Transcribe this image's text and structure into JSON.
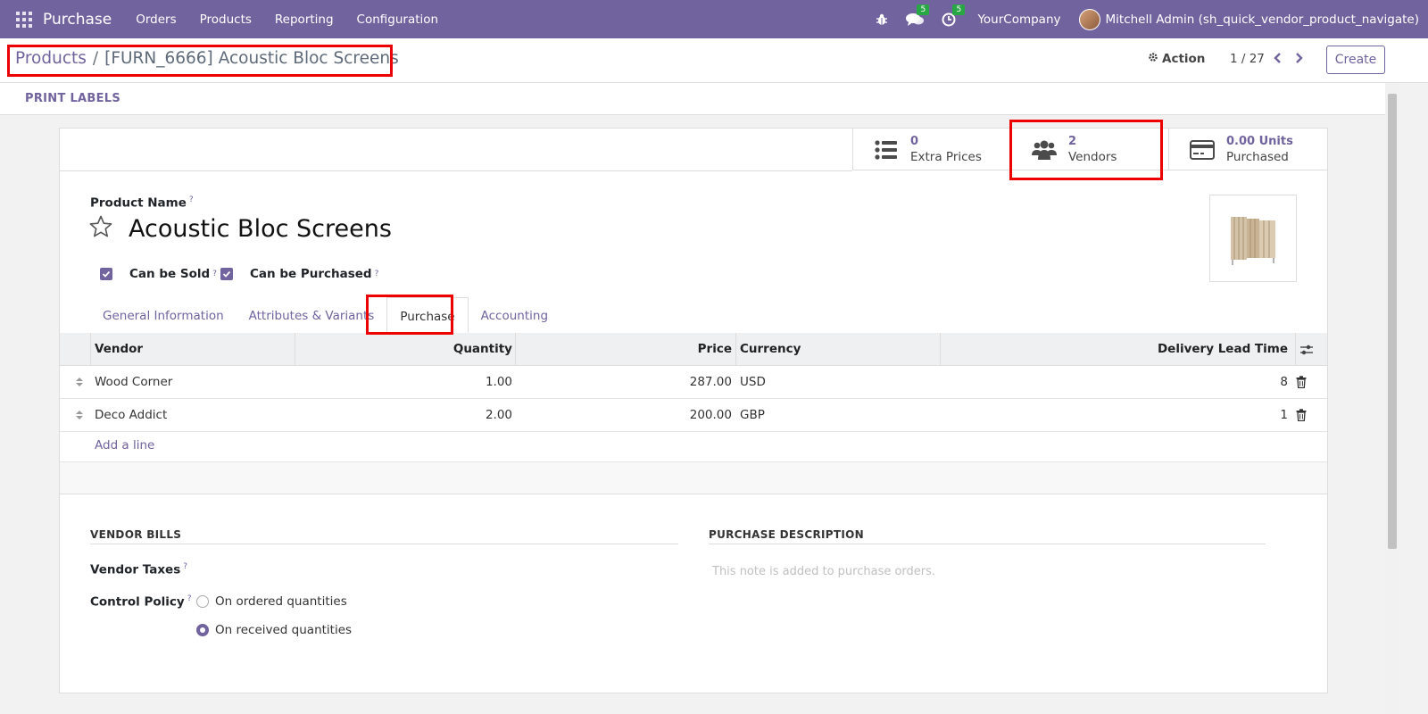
{
  "navbar": {
    "app_name": "Purchase",
    "menu": [
      "Orders",
      "Products",
      "Reporting",
      "Configuration"
    ],
    "messages_count": "5",
    "activities_count": "5",
    "company": "YourCompany",
    "user": "Mitchell Admin (sh_quick_vendor_product_navigate)"
  },
  "control": {
    "breadcrumb_parent": "Products",
    "breadcrumb_sep": "/",
    "breadcrumb_current": "[FURN_6666] Acoustic Bloc Screens",
    "action_label": "Action",
    "pager": "1 / 27",
    "create_label": "Create"
  },
  "statusbar": {
    "print_labels": "PRINT LABELS"
  },
  "smart_buttons": [
    {
      "value": "0",
      "label": "Extra Prices",
      "icon": "list-icon"
    },
    {
      "value": "2",
      "label": "Vendors",
      "icon": "users-icon"
    },
    {
      "value": "0.00 Units",
      "label": "Purchased",
      "icon": "credit-card-icon"
    }
  ],
  "product": {
    "name_label": "Product Name",
    "help_mark": "?",
    "name": "Acoustic Bloc Screens",
    "can_be_sold_label": "Can be Sold",
    "can_be_purchased_label": "Can be Purchased",
    "can_be_sold": true,
    "can_be_purchased": true
  },
  "tabs": [
    "General Information",
    "Attributes & Variants",
    "Purchase",
    "Accounting"
  ],
  "active_tab": "Purchase",
  "vendor_table": {
    "columns": [
      "Vendor",
      "Quantity",
      "Price",
      "Currency",
      "Delivery Lead Time"
    ],
    "rows": [
      {
        "vendor": "Wood Corner",
        "quantity": "1.00",
        "price": "287.00",
        "currency": "USD",
        "lead_time": "8"
      },
      {
        "vendor": "Deco Addict",
        "quantity": "2.00",
        "price": "200.00",
        "currency": "GBP",
        "lead_time": "1"
      }
    ],
    "add_line": "Add a line"
  },
  "vendor_bills": {
    "title": "VENDOR BILLS",
    "vendor_taxes_label": "Vendor Taxes",
    "control_policy_label": "Control Policy",
    "options": [
      "On ordered quantities",
      "On received quantities"
    ],
    "selected": "On received quantities"
  },
  "purchase_description": {
    "title": "PURCHASE DESCRIPTION",
    "placeholder": "This note is added to purchase orders."
  },
  "colors": {
    "brand": "#71639e",
    "highlight": "#ee0000",
    "badge": "#28a745"
  }
}
